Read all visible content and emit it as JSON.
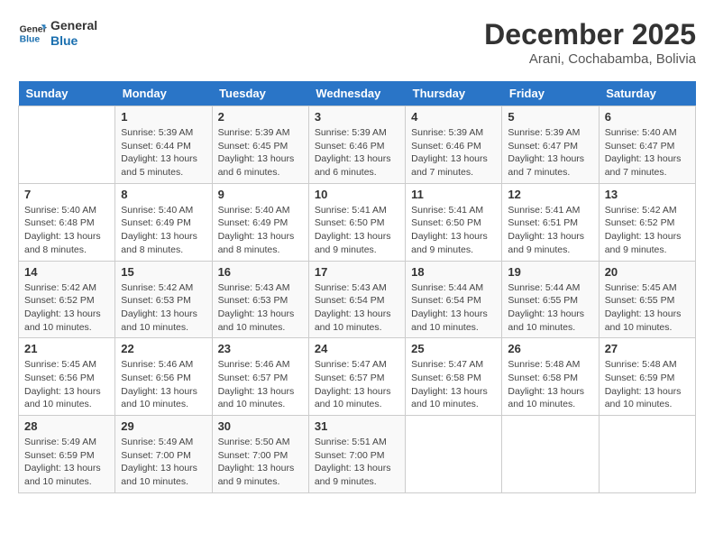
{
  "logo": {
    "line1": "General",
    "line2": "Blue"
  },
  "title": "December 2025",
  "subtitle": "Arani, Cochabamba, Bolivia",
  "weekdays": [
    "Sunday",
    "Monday",
    "Tuesday",
    "Wednesday",
    "Thursday",
    "Friday",
    "Saturday"
  ],
  "weeks": [
    [
      {
        "day": "",
        "info": ""
      },
      {
        "day": "1",
        "info": "Sunrise: 5:39 AM\nSunset: 6:44 PM\nDaylight: 13 hours\nand 5 minutes."
      },
      {
        "day": "2",
        "info": "Sunrise: 5:39 AM\nSunset: 6:45 PM\nDaylight: 13 hours\nand 6 minutes."
      },
      {
        "day": "3",
        "info": "Sunrise: 5:39 AM\nSunset: 6:46 PM\nDaylight: 13 hours\nand 6 minutes."
      },
      {
        "day": "4",
        "info": "Sunrise: 5:39 AM\nSunset: 6:46 PM\nDaylight: 13 hours\nand 7 minutes."
      },
      {
        "day": "5",
        "info": "Sunrise: 5:39 AM\nSunset: 6:47 PM\nDaylight: 13 hours\nand 7 minutes."
      },
      {
        "day": "6",
        "info": "Sunrise: 5:40 AM\nSunset: 6:47 PM\nDaylight: 13 hours\nand 7 minutes."
      }
    ],
    [
      {
        "day": "7",
        "info": "Sunrise: 5:40 AM\nSunset: 6:48 PM\nDaylight: 13 hours\nand 8 minutes."
      },
      {
        "day": "8",
        "info": "Sunrise: 5:40 AM\nSunset: 6:49 PM\nDaylight: 13 hours\nand 8 minutes."
      },
      {
        "day": "9",
        "info": "Sunrise: 5:40 AM\nSunset: 6:49 PM\nDaylight: 13 hours\nand 8 minutes."
      },
      {
        "day": "10",
        "info": "Sunrise: 5:41 AM\nSunset: 6:50 PM\nDaylight: 13 hours\nand 9 minutes."
      },
      {
        "day": "11",
        "info": "Sunrise: 5:41 AM\nSunset: 6:50 PM\nDaylight: 13 hours\nand 9 minutes."
      },
      {
        "day": "12",
        "info": "Sunrise: 5:41 AM\nSunset: 6:51 PM\nDaylight: 13 hours\nand 9 minutes."
      },
      {
        "day": "13",
        "info": "Sunrise: 5:42 AM\nSunset: 6:52 PM\nDaylight: 13 hours\nand 9 minutes."
      }
    ],
    [
      {
        "day": "14",
        "info": "Sunrise: 5:42 AM\nSunset: 6:52 PM\nDaylight: 13 hours\nand 10 minutes."
      },
      {
        "day": "15",
        "info": "Sunrise: 5:42 AM\nSunset: 6:53 PM\nDaylight: 13 hours\nand 10 minutes."
      },
      {
        "day": "16",
        "info": "Sunrise: 5:43 AM\nSunset: 6:53 PM\nDaylight: 13 hours\nand 10 minutes."
      },
      {
        "day": "17",
        "info": "Sunrise: 5:43 AM\nSunset: 6:54 PM\nDaylight: 13 hours\nand 10 minutes."
      },
      {
        "day": "18",
        "info": "Sunrise: 5:44 AM\nSunset: 6:54 PM\nDaylight: 13 hours\nand 10 minutes."
      },
      {
        "day": "19",
        "info": "Sunrise: 5:44 AM\nSunset: 6:55 PM\nDaylight: 13 hours\nand 10 minutes."
      },
      {
        "day": "20",
        "info": "Sunrise: 5:45 AM\nSunset: 6:55 PM\nDaylight: 13 hours\nand 10 minutes."
      }
    ],
    [
      {
        "day": "21",
        "info": "Sunrise: 5:45 AM\nSunset: 6:56 PM\nDaylight: 13 hours\nand 10 minutes."
      },
      {
        "day": "22",
        "info": "Sunrise: 5:46 AM\nSunset: 6:56 PM\nDaylight: 13 hours\nand 10 minutes."
      },
      {
        "day": "23",
        "info": "Sunrise: 5:46 AM\nSunset: 6:57 PM\nDaylight: 13 hours\nand 10 minutes."
      },
      {
        "day": "24",
        "info": "Sunrise: 5:47 AM\nSunset: 6:57 PM\nDaylight: 13 hours\nand 10 minutes."
      },
      {
        "day": "25",
        "info": "Sunrise: 5:47 AM\nSunset: 6:58 PM\nDaylight: 13 hours\nand 10 minutes."
      },
      {
        "day": "26",
        "info": "Sunrise: 5:48 AM\nSunset: 6:58 PM\nDaylight: 13 hours\nand 10 minutes."
      },
      {
        "day": "27",
        "info": "Sunrise: 5:48 AM\nSunset: 6:59 PM\nDaylight: 13 hours\nand 10 minutes."
      }
    ],
    [
      {
        "day": "28",
        "info": "Sunrise: 5:49 AM\nSunset: 6:59 PM\nDaylight: 13 hours\nand 10 minutes."
      },
      {
        "day": "29",
        "info": "Sunrise: 5:49 AM\nSunset: 7:00 PM\nDaylight: 13 hours\nand 10 minutes."
      },
      {
        "day": "30",
        "info": "Sunrise: 5:50 AM\nSunset: 7:00 PM\nDaylight: 13 hours\nand 9 minutes."
      },
      {
        "day": "31",
        "info": "Sunrise: 5:51 AM\nSunset: 7:00 PM\nDaylight: 13 hours\nand 9 minutes."
      },
      {
        "day": "",
        "info": ""
      },
      {
        "day": "",
        "info": ""
      },
      {
        "day": "",
        "info": ""
      }
    ]
  ]
}
